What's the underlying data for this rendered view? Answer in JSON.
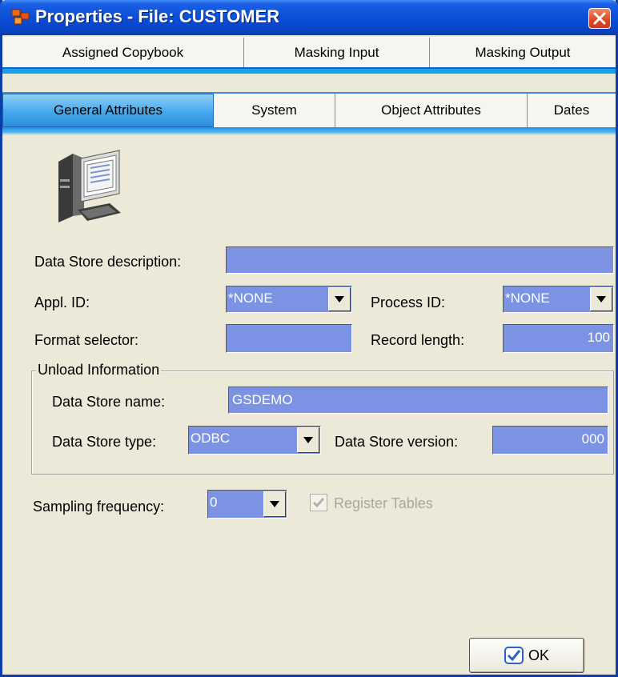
{
  "window": {
    "title": "Properties - File: CUSTOMER"
  },
  "tabs_back": [
    "Assigned Copybook",
    "Masking Input",
    "Masking Output"
  ],
  "tabs_front": [
    "General Attributes",
    "System",
    "Object Attributes",
    "Dates"
  ],
  "active_tab": "General Attributes",
  "form": {
    "description_label": "Data Store description:",
    "description_value": "",
    "appl_id_label": "Appl. ID:",
    "appl_id_value": "*NONE",
    "process_id_label": "Process ID:",
    "process_id_value": "*NONE",
    "format_selector_label": "Format selector:",
    "format_selector_value": "",
    "record_length_label": "Record length:",
    "record_length_value": "100"
  },
  "unload": {
    "group_title": "Unload Information",
    "name_label": "Data Store name:",
    "name_value": "GSDEMO",
    "type_label": "Data Store type:",
    "type_value": "ODBC",
    "version_label": "Data Store version:",
    "version_value": "000"
  },
  "sampling": {
    "label": "Sampling frequency:",
    "value": "0",
    "register_label": "Register Tables",
    "register_checked": true
  },
  "buttons": {
    "ok": "OK"
  },
  "colors": {
    "title_blue": "#0a4fd6",
    "field_blue": "#7b93e2",
    "tab_active": "#46a8ec",
    "dialog_bg": "#ece9d8"
  },
  "icons": [
    "app-icon",
    "close-icon",
    "computer-icon",
    "dropdown-arrow-icon",
    "checkmark-icon",
    "ok-check-icon"
  ]
}
